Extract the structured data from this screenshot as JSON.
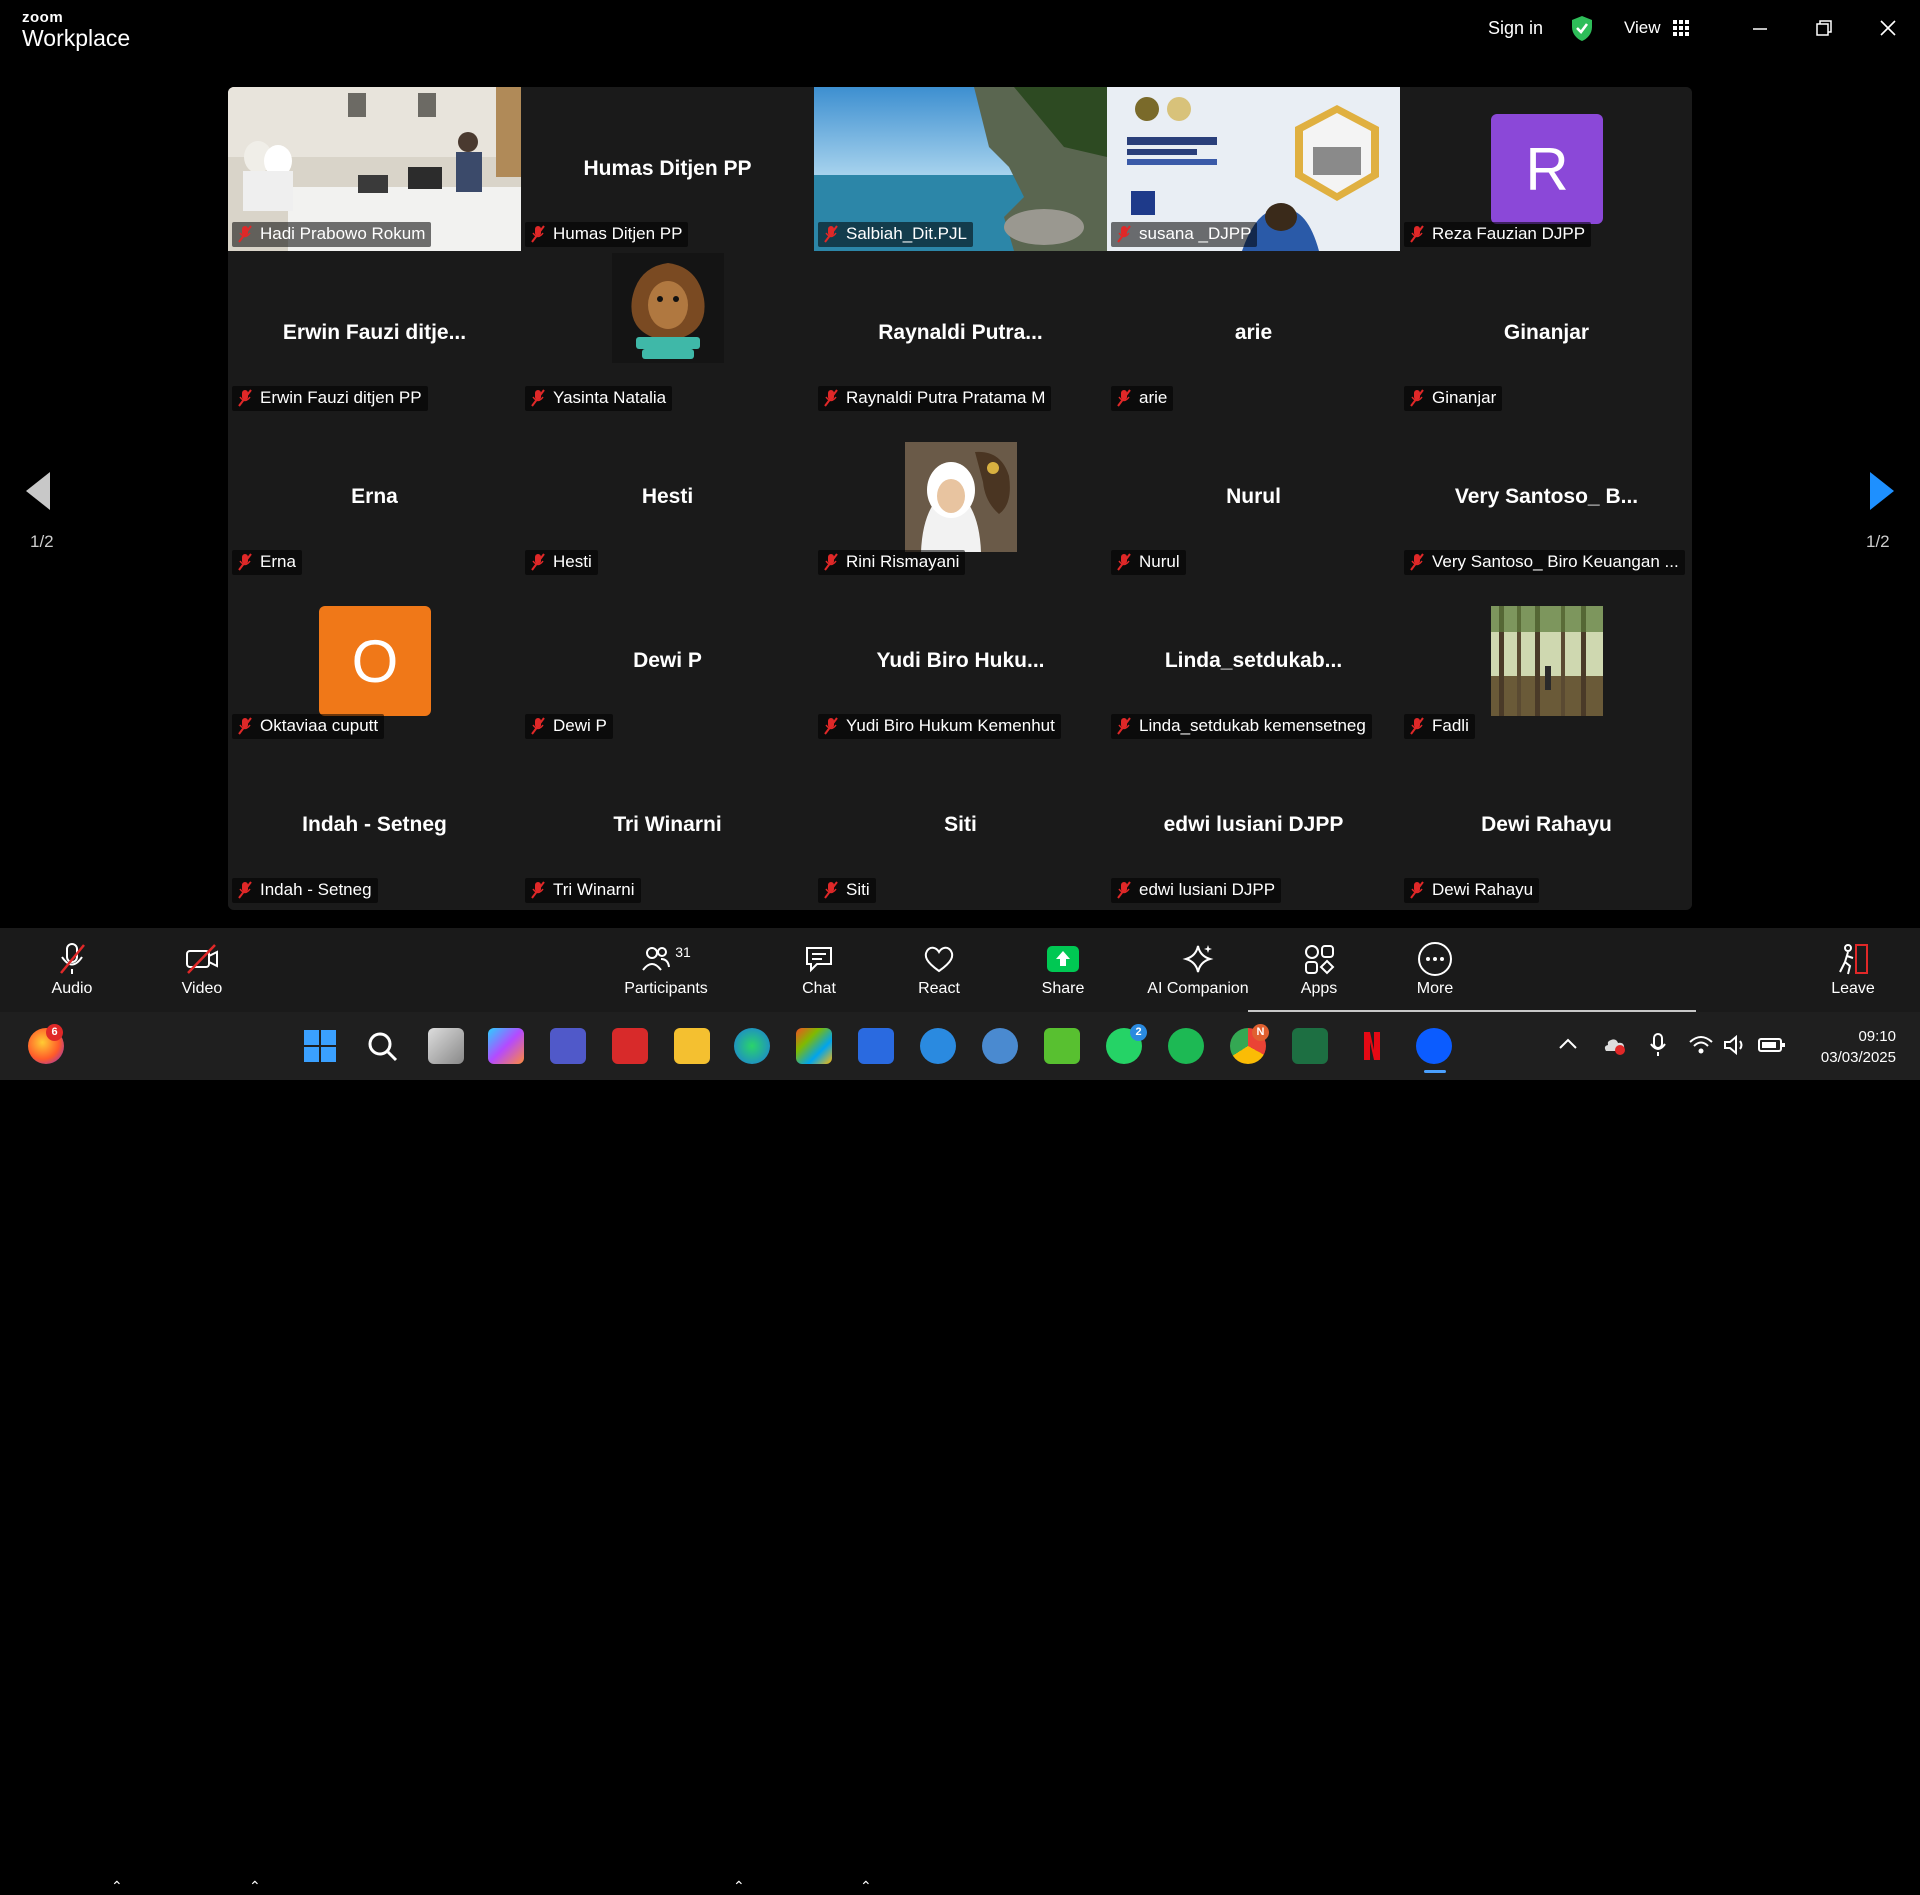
{
  "app": {
    "logo_top": "zoom",
    "logo_bottom": "Workplace",
    "sign_in": "Sign in",
    "view": "View"
  },
  "pagination": {
    "left": "1/2",
    "right": "1/2"
  },
  "tiles": [
    {
      "label": "Hadi Prabowo Rokum",
      "name": ""
    },
    {
      "label": "Humas Ditjen PP",
      "name": "Humas Ditjen PP"
    },
    {
      "label": "Salbiah_Dit.PJL",
      "name": ""
    },
    {
      "label": "susana _DJPP",
      "name": ""
    },
    {
      "label": "Reza Fauzian DJPP",
      "name": "",
      "avatar": "R",
      "avatar_color": "#8b48d8"
    },
    {
      "label": "Erwin Fauzi ditjen PP",
      "name": "Erwin Fauzi ditje..."
    },
    {
      "label": "Yasinta Natalia",
      "name": ""
    },
    {
      "label": "Raynaldi Putra Pratama M",
      "name": "Raynaldi  Putra..."
    },
    {
      "label": "arie",
      "name": "arie"
    },
    {
      "label": "Ginanjar",
      "name": "Ginanjar"
    },
    {
      "label": "Erna",
      "name": "Erna"
    },
    {
      "label": "Hesti",
      "name": "Hesti"
    },
    {
      "label": "Rini Rismayani",
      "name": ""
    },
    {
      "label": "Nurul",
      "name": "Nurul"
    },
    {
      "label": "Very Santoso_ Biro Keuangan ...",
      "name": "Very Santoso_ B..."
    },
    {
      "label": "Oktaviaa cuputt",
      "name": "",
      "avatar": "O",
      "avatar_color": "#f07818"
    },
    {
      "label": "Dewi P",
      "name": "Dewi P"
    },
    {
      "label": "Yudi Biro Hukum Kemenhut",
      "name": "Yudi Biro  Huku..."
    },
    {
      "label": "Linda_setdukab kemensetneg",
      "name": "Linda_setdukab..."
    },
    {
      "label": "Fadli",
      "name": ""
    },
    {
      "label": "Indah - Setneg",
      "name": "Indah - Setneg"
    },
    {
      "label": "Tri Winarni",
      "name": "Tri Winarni"
    },
    {
      "label": "Siti",
      "name": "Siti"
    },
    {
      "label": "edwi lusiani DJPP",
      "name": "edwi lusiani DJPP"
    },
    {
      "label": "Dewi Rahayu",
      "name": "Dewi Rahayu"
    }
  ],
  "toolbar": {
    "audio": "Audio",
    "video": "Video",
    "participants": "Participants",
    "participants_count": "31",
    "chat": "Chat",
    "react": "React",
    "share": "Share",
    "ai_companion": "AI Companion",
    "apps": "Apps",
    "more": "More",
    "leave": "Leave"
  },
  "taskbar": {
    "time": "09:10",
    "date": "03/03/2025",
    "firefox_badge": "6",
    "whatsapp_badge": "2",
    "chrome_badge": "N"
  },
  "colors": {
    "accent": "#0e72ed",
    "share": "#00c853",
    "mute": "#e02828"
  }
}
